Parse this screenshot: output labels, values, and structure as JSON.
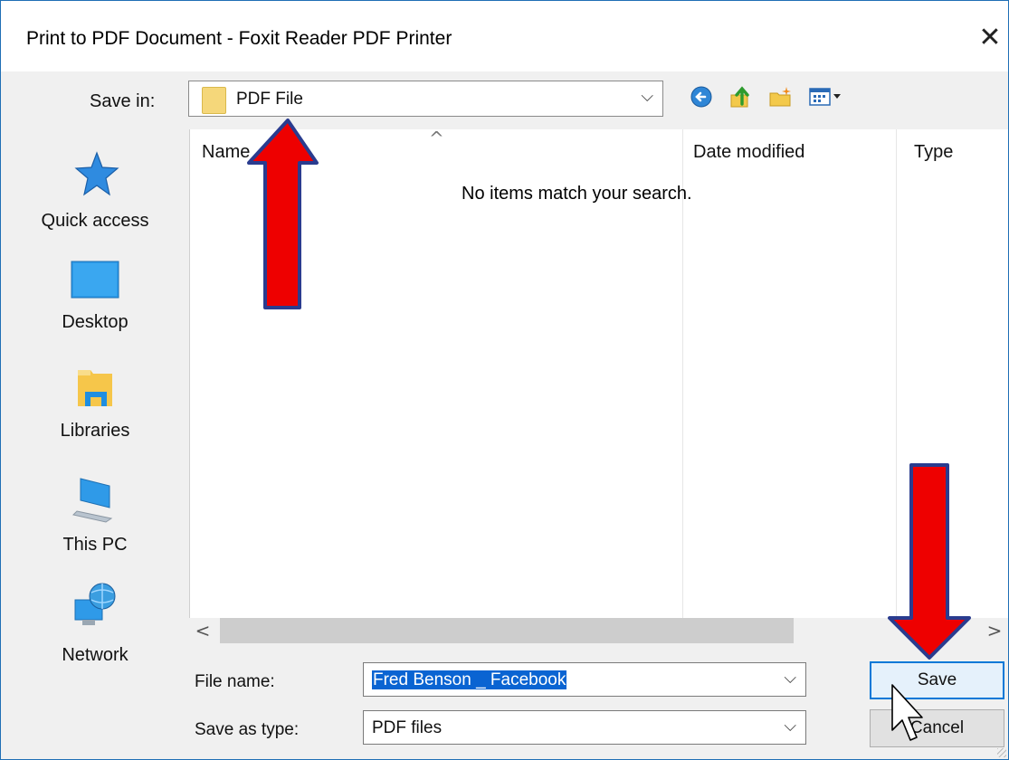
{
  "window": {
    "title": "Print to PDF Document - Foxit Reader PDF Printer",
    "close_glyph": "✕"
  },
  "save_in": {
    "label": "Save in:",
    "value": "PDF File",
    "arrow": "⌵"
  },
  "toolbar_icons": [
    "back-icon",
    "up-folder-icon",
    "new-folder-icon",
    "view-menu-icon"
  ],
  "nav_items": [
    {
      "label": "Quick access",
      "icon": "star-icon"
    },
    {
      "label": "Desktop",
      "icon": "desktop-icon"
    },
    {
      "label": "Libraries",
      "icon": "libraries-icon"
    },
    {
      "label": "This PC",
      "icon": "computer-icon"
    },
    {
      "label": "Network",
      "icon": "network-icon"
    }
  ],
  "file_list": {
    "columns": [
      "Name",
      "Date modified",
      "Type"
    ],
    "sort_caret": "^",
    "empty_message": "No items match your search."
  },
  "scrollbar": {
    "left": "<",
    "right": ">"
  },
  "file_name": {
    "label": "File name:",
    "value": "Fred Benson _ Facebook",
    "arrow": "⌵"
  },
  "save_as_type": {
    "label": "Save as type:",
    "value": "PDF files",
    "arrow": "⌵"
  },
  "buttons": {
    "save": "Save",
    "cancel": "Cancel"
  },
  "annotations": {
    "arrow_color": "#ee0000",
    "arrow_outline": "#2a3c8f"
  },
  "colors": {
    "selection": "#0a64d2",
    "window_border": "#1f6fb5",
    "dialog_bg": "#f0f0f0"
  }
}
